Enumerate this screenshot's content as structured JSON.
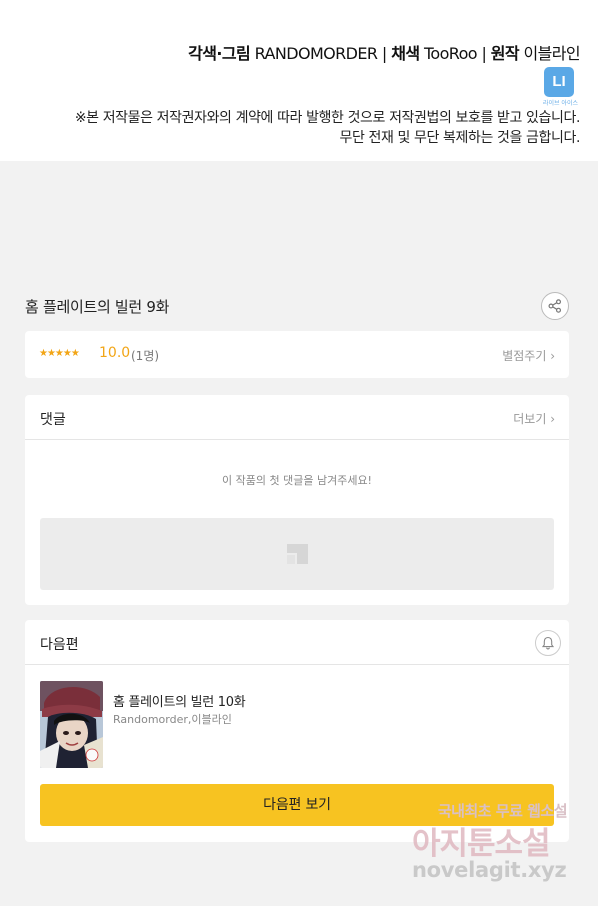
{
  "credits": {
    "adapt_label": "각색·그림",
    "adapt_name": "RANDOMORDER",
    "sep1": "|",
    "color_label": "채색",
    "color_name": "TooRoo",
    "sep2": "|",
    "original_label": "원작",
    "original_name": "이블라인",
    "logo_text": "LI",
    "logo_caption": "라이브 아이스",
    "copyright_line1": "※본 저작물은 저작권자와의 계약에 따라 발행한 것으로 저작권법의 보호를 받고 있습니다.",
    "copyright_line2": "무단 전재 및 무단 복제하는 것을 금합니다."
  },
  "episode": {
    "title": "홈 플레이트의 빌런 9화",
    "share_icon": "share-icon"
  },
  "rating": {
    "stars": "★★★★★",
    "star_level": 1.0,
    "score": "10.0",
    "count": "(1명)",
    "rate_link": "별점주기 ›"
  },
  "comments": {
    "title": "댓글",
    "more": "더보기 ›",
    "empty_message": "이 작품의 첫 댓글을 남겨주세요!",
    "input_icon": "comment-placeholder-icon"
  },
  "next_episode": {
    "section_title": "다음편",
    "bell_icon": "bell-icon",
    "title": "홈 플레이트의 빌런 10화",
    "author": "Randomorder,이블라인",
    "button_label": "다음편 보기"
  },
  "watermark": {
    "line1": "국내최초 무료 웹소설",
    "line2": "아지툰소설",
    "line3": "novelagit.xyz"
  },
  "colors": {
    "accent_yellow": "#f7c321",
    "star_orange": "#f2a516",
    "logo_blue": "#5aa8e6",
    "background": "#f2f2f2"
  }
}
